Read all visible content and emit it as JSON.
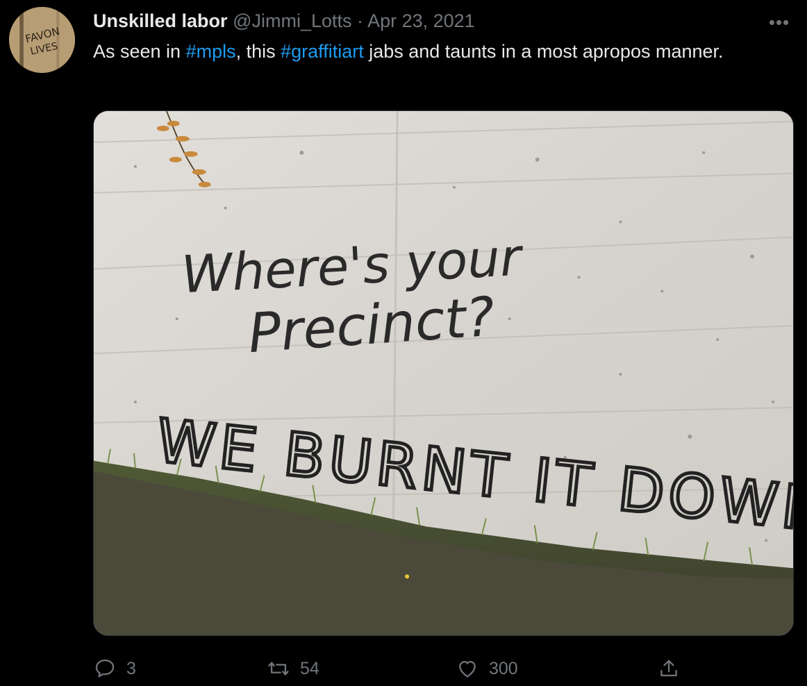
{
  "tweet": {
    "author_name": "Unskilled labor",
    "handle": "@Jimmi_Lotts",
    "separator": "·",
    "date": "Apr 23, 2021",
    "text_1": "As seen in ",
    "hashtag_1": "#mpls",
    "text_2": ", this ",
    "hashtag_2": "#graffitiart",
    "text_3": " jabs and taunts in a most apropos manner.",
    "more_label": "•••"
  },
  "avatar": {
    "text_line_1": "FAVON",
    "text_line_2": "LIVES"
  },
  "image": {
    "graffiti_line_1": "Where's your",
    "graffiti_line_2": "Precinct?",
    "graffiti_line_3": "WE BURNT IT DOWN"
  },
  "actions": {
    "replies": "3",
    "retweets": "54",
    "likes": "300"
  },
  "icons": {
    "reply": "reply-icon",
    "retweet": "retweet-icon",
    "like": "heart-icon",
    "share": "share-icon",
    "more": "more-icon"
  },
  "colors": {
    "background": "#000000",
    "text": "#e7e9ea",
    "muted": "#71767b",
    "link": "#1d9bf0"
  }
}
